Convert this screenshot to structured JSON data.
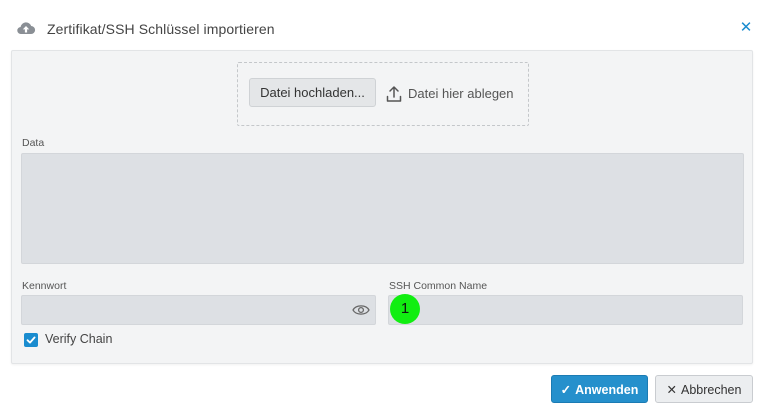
{
  "dialog": {
    "title": "Zertifikat/SSH Schlüssel importieren",
    "close_icon": "close-icon",
    "header_icon": "cloud-upload-icon"
  },
  "upload": {
    "button_label": "Datei hochladen...",
    "drop_label": "Datei hier ablegen",
    "drop_icon": "upload-icon"
  },
  "form": {
    "data_label": "Data",
    "data_value": "",
    "password_label": "Kennwort",
    "password_value": "",
    "password_toggle_icon": "eye-icon",
    "ssh_label": "SSH Common Name",
    "ssh_value": "",
    "verify_chain_label": "Verify Chain",
    "verify_chain_checked": true
  },
  "marker": {
    "text": "1",
    "color": "#11ee11"
  },
  "footer": {
    "apply_label": "Anwenden",
    "cancel_label": "Abbrechen"
  },
  "colors": {
    "accent": "#2590cc",
    "panel_bg": "#f3f4f5",
    "field_bg": "#dde0e4"
  }
}
